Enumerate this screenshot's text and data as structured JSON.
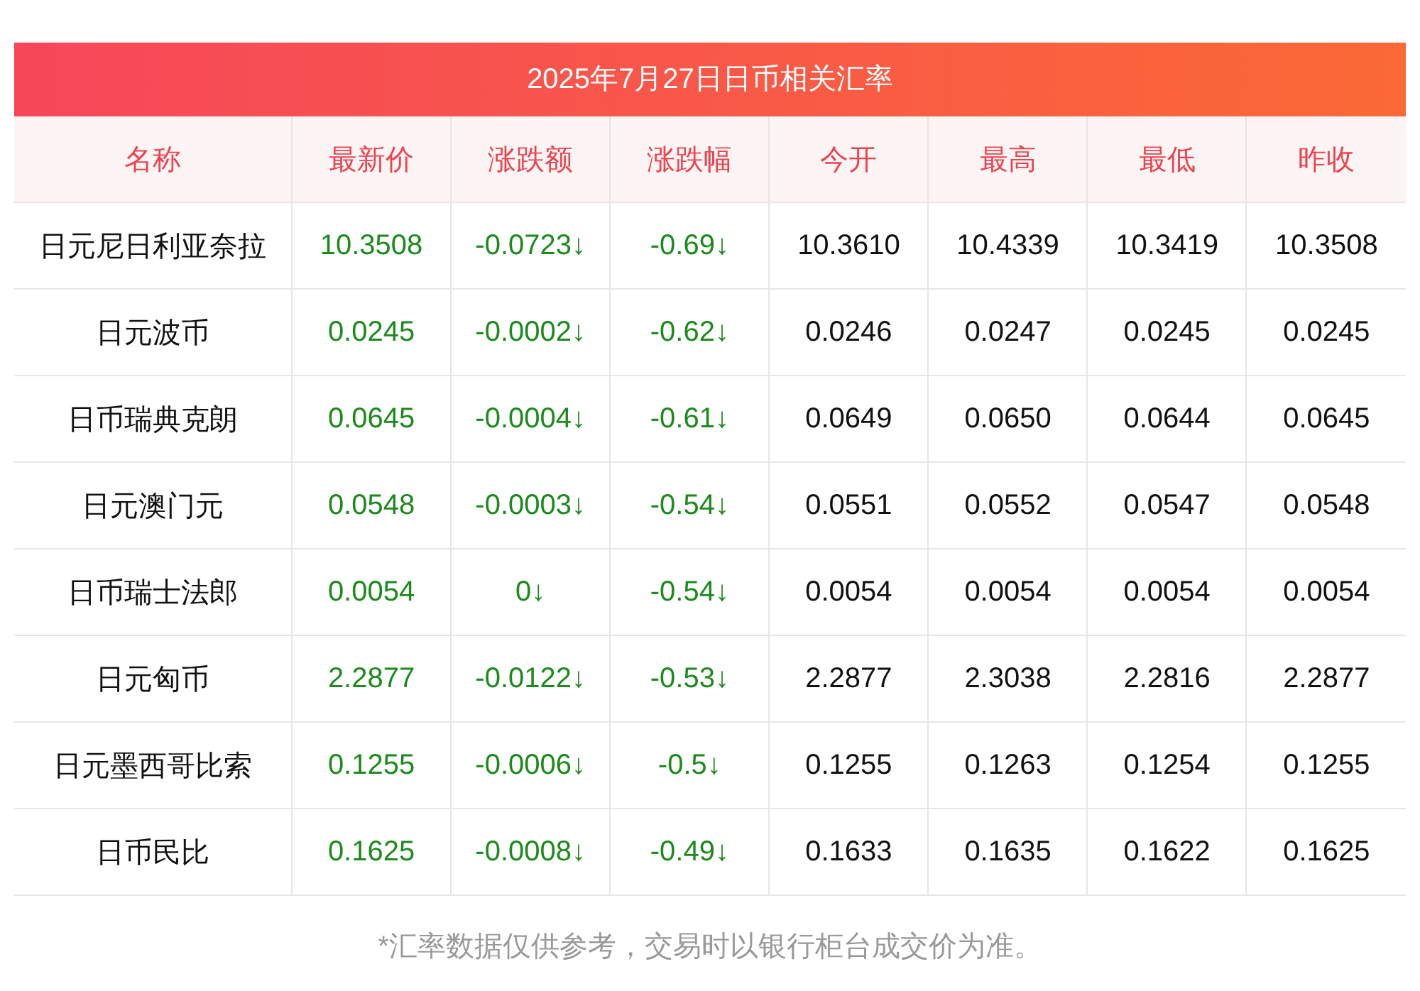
{
  "title": "2025年7月27日日币相关汇率",
  "table": {
    "columns": [
      "名称",
      "最新价",
      "涨跌额",
      "涨跌幅",
      "今开",
      "最高",
      "最低",
      "昨收"
    ],
    "rows": [
      {
        "falling": true,
        "cells": [
          "日元尼日利亚奈拉",
          "10.3508",
          "-0.0723↓",
          "-0.69↓",
          "10.3610",
          "10.4339",
          "10.3419",
          "10.3508"
        ]
      },
      {
        "falling": true,
        "cells": [
          "日元波币",
          "0.0245",
          "-0.0002↓",
          "-0.62↓",
          "0.0246",
          "0.0247",
          "0.0245",
          "0.0245"
        ]
      },
      {
        "falling": true,
        "cells": [
          "日币瑞典克朗",
          "0.0645",
          "-0.0004↓",
          "-0.61↓",
          "0.0649",
          "0.0650",
          "0.0644",
          "0.0645"
        ]
      },
      {
        "falling": true,
        "cells": [
          "日元澳门元",
          "0.0548",
          "-0.0003↓",
          "-0.54↓",
          "0.0551",
          "0.0552",
          "0.0547",
          "0.0548"
        ]
      },
      {
        "falling": true,
        "cells": [
          "日币瑞士法郎",
          "0.0054",
          "0↓",
          "-0.54↓",
          "0.0054",
          "0.0054",
          "0.0054",
          "0.0054"
        ]
      },
      {
        "falling": true,
        "cells": [
          "日元匈币",
          "2.2877",
          "-0.0122↓",
          "-0.53↓",
          "2.2877",
          "2.3038",
          "2.2816",
          "2.2877"
        ]
      },
      {
        "falling": true,
        "cells": [
          "日元墨西哥比索",
          "0.1255",
          "-0.0006↓",
          "-0.5↓",
          "0.1255",
          "0.1263",
          "0.1254",
          "0.1255"
        ]
      },
      {
        "falling": true,
        "cells": [
          "日币民比",
          "0.1625",
          "-0.0008↓",
          "-0.49↓",
          "0.1633",
          "0.1635",
          "0.1622",
          "0.1625"
        ]
      }
    ]
  },
  "footnote": "*汇率数据仅供参考，交易时以银行柜台成交价为准。"
}
